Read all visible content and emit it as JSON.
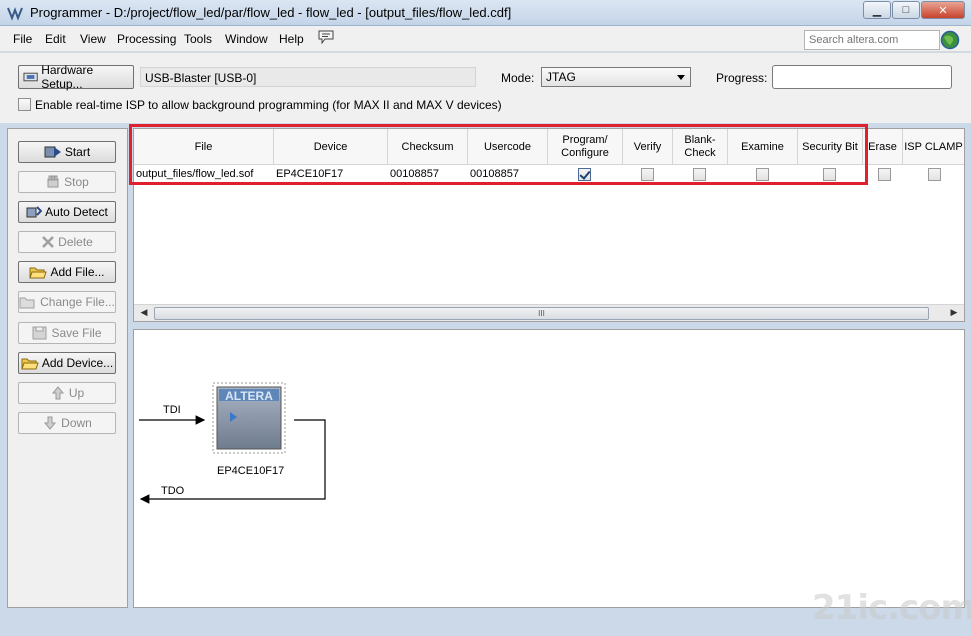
{
  "window": {
    "title": "Programmer - D:/project/flow_led/par/flow_led - flow_led - [output_files/flow_led.cdf]"
  },
  "menu": {
    "items": [
      "File",
      "Edit",
      "View",
      "Processing",
      "Tools",
      "Window",
      "Help"
    ],
    "search_placeholder": "Search altera.com"
  },
  "toolbar": {
    "hardware_setup_label": "Hardware Setup...",
    "hardware_value": "USB-Blaster [USB-0]",
    "mode_label": "Mode:",
    "mode_value": "JTAG",
    "progress_label": "Progress:",
    "isp_label": "Enable real-time ISP to allow background programming (for MAX II and MAX V devices)"
  },
  "left_buttons": {
    "start": "Start",
    "stop": "Stop",
    "auto_detect": "Auto Detect",
    "delete": "Delete",
    "add_file": "Add File...",
    "change_file": "Change File...",
    "save_file": "Save File",
    "add_device": "Add Device...",
    "up": "Up",
    "down": "Down"
  },
  "table": {
    "headers": {
      "file": "File",
      "device": "Device",
      "checksum": "Checksum",
      "usercode": "Usercode",
      "program_configure": "Program/ Configure",
      "verify": "Verify",
      "blank_check": "Blank- Check",
      "examine": "Examine",
      "security_bit": "Security Bit",
      "erase": "Erase",
      "isp_clamp": "ISP CLAMP"
    },
    "row": {
      "file": "output_files/flow_led.sof",
      "device": "EP4CE10F17",
      "checksum": "00108857",
      "usercode": "00108857",
      "program_configure": true,
      "verify": false,
      "blank_check": false,
      "examine": false,
      "security_bit": false,
      "erase": false,
      "isp_clamp": false
    },
    "scrollbar_grip": "III"
  },
  "chain": {
    "tdi_label": "TDI",
    "tdo_label": "TDO",
    "chip_logo": "ALTERA",
    "device_name": "EP4CE10F17"
  },
  "watermark": "21ic.com",
  "colors": {
    "highlight_box": "#e0202c",
    "window_frame": "#ccd9e8"
  }
}
